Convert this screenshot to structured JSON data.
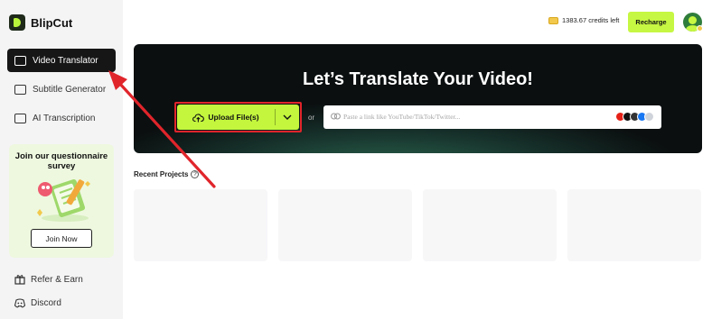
{
  "app": {
    "name": "BlipCut"
  },
  "sidebar": {
    "items": [
      {
        "label": "Video Translator",
        "icon": "video-translate-icon",
        "active": true
      },
      {
        "label": "Subtitle Generator",
        "icon": "subtitle-icon",
        "active": false
      },
      {
        "label": "AI Transcription",
        "icon": "transcription-icon",
        "active": false
      }
    ],
    "promo": {
      "title": "Join our questionnaire survey",
      "button": "Join Now"
    },
    "bottom": [
      {
        "label": "Refer & Earn",
        "icon": "gift-icon"
      },
      {
        "label": "Discord",
        "icon": "discord-icon"
      }
    ]
  },
  "header": {
    "credits": "1383.67 credits left",
    "recharge": "Recharge"
  },
  "hero": {
    "title": "Let’s Translate Your Video!",
    "upload": "Upload File(s)",
    "or": "or",
    "link_placeholder": "Paste a link like YouTube/TikTok/Twitter...",
    "platform_icons": [
      "youtube-icon",
      "tiktok-icon",
      "x-icon",
      "facebook-icon",
      "more-icon"
    ]
  },
  "recent": {
    "title": "Recent Projects",
    "info": "?"
  },
  "colors": {
    "accent": "#c3f63d",
    "highlight": "#e0252b",
    "sidebar_active": "#161616"
  }
}
